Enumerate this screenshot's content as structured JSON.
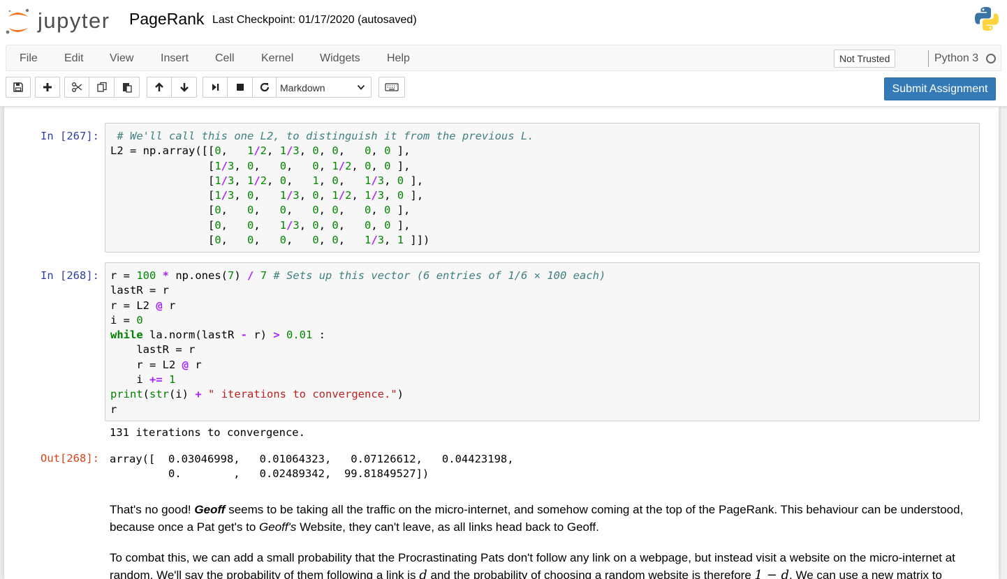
{
  "header": {
    "logo_text": "jupyter",
    "notebook_name": "PageRank",
    "checkpoint": "Last Checkpoint: 01/17/2020 (autosaved)"
  },
  "menubar": {
    "items": [
      "File",
      "Edit",
      "View",
      "Insert",
      "Cell",
      "Kernel",
      "Widgets",
      "Help"
    ],
    "trust_status": "Not Trusted",
    "kernel": "Python 3"
  },
  "toolbar": {
    "cell_type": "Markdown",
    "submit_label": "Submit Assignment"
  },
  "cells": {
    "cell1": {
      "prompt": "In [267]:"
    },
    "cell2": {
      "prompt": "In [268]:",
      "stdout": "131 iterations to convergence.",
      "out_prompt": "Out[268]:"
    }
  },
  "markdown": {
    "p1_a": "That's no good! ",
    "p1_geoff": "Geoff",
    "p1_b": " seems to be taking all the traffic on the micro-internet, and somehow coming at the top of the PageRank. This behaviour can be understood, because once a Pat get's to ",
    "p1_geoffs": "Geoff's",
    "p1_c": " Website, they can't leave, as all links head back to Geoff.",
    "p2_a": "To combat this, we can add a small probability that the Procrastinating Pats don't follow any link on a webpage, but instead visit a website on the micro-internet at random. We'll say the probability of them following a link is ",
    "p2_d1": "d",
    "p2_b": " and the probability of choosing a random website is therefore ",
    "p2_expr": "1 − d",
    "p2_c": ". We can use a new matrix to"
  }
}
